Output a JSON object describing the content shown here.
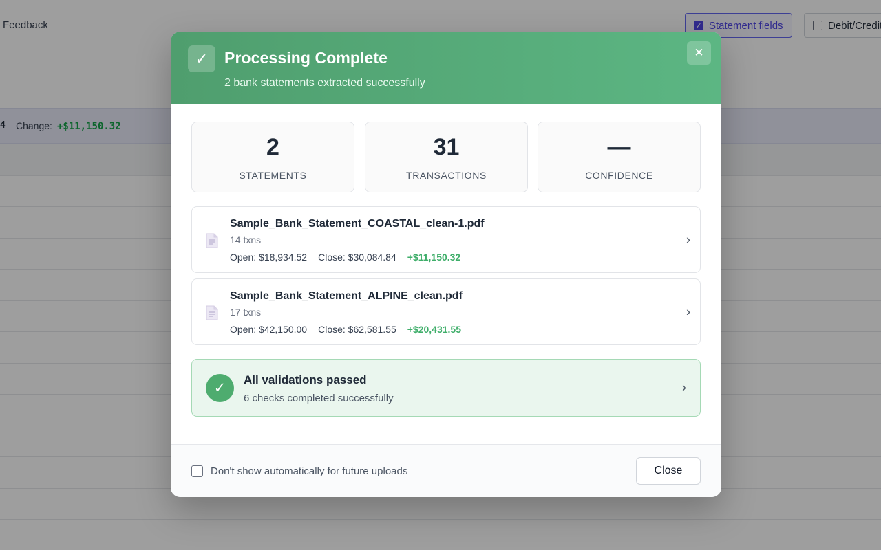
{
  "background": {
    "toolbar": {
      "feedback_label": "Feedback",
      "statement_fields_label": "Statement fields",
      "statement_fields_checked": true,
      "debit_credit_label": "Debit/Credit",
      "debit_credit_checked": false
    },
    "summary_band": {
      "edge_text": "4",
      "change_label": "Change:",
      "change_value": "+$11,150.32",
      "change_color": "#16a34a"
    }
  },
  "modal": {
    "header": {
      "icon": "check-icon",
      "title": "Processing Complete",
      "subtitle": "2 bank statements extracted successfully",
      "close_icon": "close-icon",
      "gradient_start": "#4f9e6e",
      "gradient_end": "#5cb683"
    },
    "stats": [
      {
        "value": "2",
        "label": "Statements"
      },
      {
        "value": "31",
        "label": "Transactions"
      },
      {
        "value": "—",
        "label": "Confidence"
      }
    ],
    "files": [
      {
        "name": "Sample_Bank_Statement_COASTAL_clean-1.pdf",
        "txns": "14 txns",
        "open": "Open: $18,934.52",
        "close": "Close: $30,084.84",
        "change": "+$11,150.32"
      },
      {
        "name": "Sample_Bank_Statement_ALPINE_clean.pdf",
        "txns": "17 txns",
        "open": "Open: $42,150.00",
        "close": "Close: $62,581.55",
        "change": "+$20,431.55"
      }
    ],
    "validation": {
      "icon": "check-circle-icon",
      "title": "All validations passed",
      "subtitle": "6 checks completed successfully",
      "accent_color": "#4eac6f"
    },
    "footer": {
      "checkbox_label": "Don't show automatically for future uploads",
      "checkbox_checked": false,
      "close_label": "Close"
    }
  }
}
